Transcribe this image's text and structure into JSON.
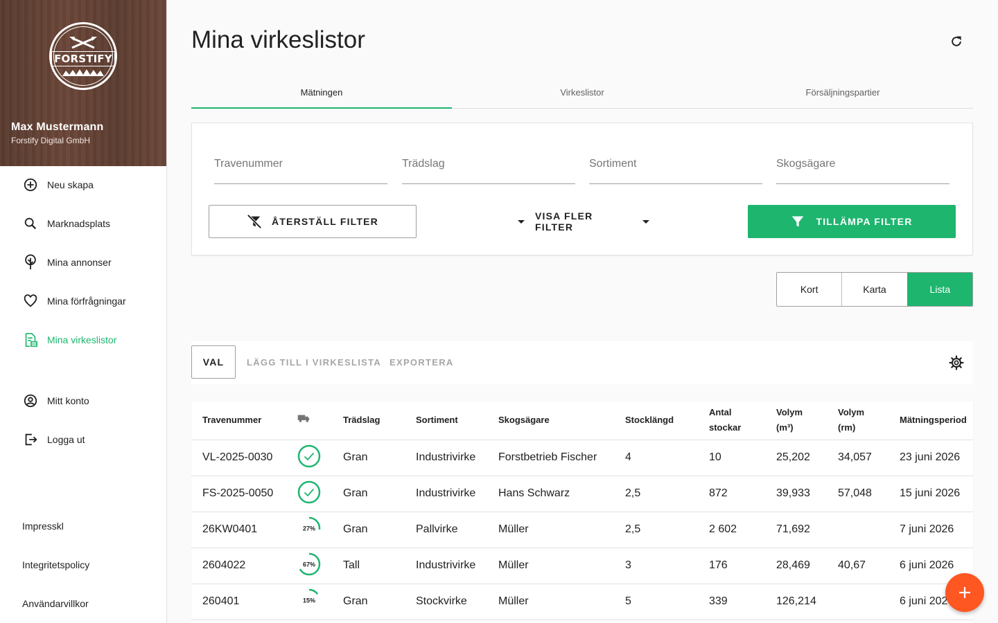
{
  "sidebar": {
    "logo_text": "FORSTIFY",
    "user_name": "Max Mustermann",
    "user_company": "Forstify Digital GmbH",
    "nav": [
      {
        "label": "Neu skapa",
        "icon": "plus-circle-icon"
      },
      {
        "label": "Marknadsplats",
        "icon": "search-icon"
      },
      {
        "label": "Mina annonser",
        "icon": "tree-icon"
      },
      {
        "label": "Mina förfrågningar",
        "icon": "heart-icon"
      },
      {
        "label": "Mina virkeslistor",
        "icon": "document-list-icon",
        "active": true
      },
      {
        "label": "Mitt konto",
        "icon": "account-circle-icon"
      },
      {
        "label": "Logga ut",
        "icon": "logout-icon"
      }
    ],
    "footer": [
      "Impresskl",
      "Integritetspolicy",
      "Användarvillkor"
    ]
  },
  "header": {
    "title": "Mina virkeslistor"
  },
  "tabs": [
    "Mätningen",
    "Virkeslistor",
    "Försäljningspartier"
  ],
  "filters": {
    "fields": [
      {
        "placeholder": "Travenummer",
        "value": ""
      },
      {
        "placeholder": "Trädslag",
        "value": ""
      },
      {
        "placeholder": "Sortiment",
        "value": ""
      },
      {
        "placeholder": "Skogsägare",
        "value": ""
      }
    ],
    "reset_label": "ÅTERSTÄLL FILTER",
    "more_label": "VISA FLER FILTER",
    "apply_label": "TILLÄMPA FILTER"
  },
  "view_toggle": {
    "options": [
      "Kort",
      "Karta",
      "Lista"
    ],
    "selected": "Lista"
  },
  "actions": {
    "select_label": "VAL",
    "add_label": "LÄGG TILL I VIRKESLISTA",
    "export_label": "EXPORTERA"
  },
  "colors": {
    "accent": "#1eb56f",
    "fab": "#ff5722"
  },
  "table": {
    "columns": [
      {
        "line1": "Travenummer",
        "line2": ""
      },
      {
        "line1": "",
        "line2": "",
        "icon": "truck-icon"
      },
      {
        "line1": "Trädslag",
        "line2": ""
      },
      {
        "line1": "Sortiment",
        "line2": ""
      },
      {
        "line1": "Skogsägare",
        "line2": ""
      },
      {
        "line1": "Stocklängd",
        "line2": ""
      },
      {
        "line1": "Antal",
        "line2": "stockar"
      },
      {
        "line1": "Volym",
        "line2": "(m³)"
      },
      {
        "line1": "Volym",
        "line2": "(rm)"
      },
      {
        "line1": "Mätningsperiod",
        "line2": ""
      }
    ],
    "rows": [
      {
        "trave": "VL-2025-0030",
        "status": "done",
        "progress": 100,
        "progress_label": "",
        "species": "Gran",
        "assortment": "Industrivirke",
        "owner": "Forstbetrieb Fischer",
        "length": "4",
        "count": "10",
        "vol_m3": "25,202",
        "vol_rm": "34,057",
        "period": "23 juni 2026"
      },
      {
        "trave": "FS-2025-0050",
        "status": "done",
        "progress": 100,
        "progress_label": "",
        "species": "Gran",
        "assortment": "Industrivirke",
        "owner": "Hans Schwarz",
        "length": "2,5",
        "count": "872",
        "vol_m3": "39,933",
        "vol_rm": "57,048",
        "period": "15 juni 2026"
      },
      {
        "trave": "26KW0401",
        "status": "progress",
        "progress": 27,
        "progress_label": "27%",
        "species": "Gran",
        "assortment": "Pallvirke",
        "owner": "Müller",
        "length": "2,5",
        "count": "2 602",
        "vol_m3": "71,692",
        "vol_rm": "",
        "period": "7 juni 2026"
      },
      {
        "trave": "2604022",
        "status": "progress",
        "progress": 67,
        "progress_label": "67%",
        "species": "Tall",
        "assortment": "Industrivirke",
        "owner": "Müller",
        "length": "3",
        "count": "176",
        "vol_m3": "28,469",
        "vol_rm": "40,67",
        "period": "6 juni 2026"
      },
      {
        "trave": "260401",
        "status": "progress",
        "progress": 15,
        "progress_label": "15%",
        "species": "Gran",
        "assortment": "Stockvirke",
        "owner": "Müller",
        "length": "5",
        "count": "339",
        "vol_m3": "126,214",
        "vol_rm": "",
        "period": "6 juni 2026"
      }
    ]
  }
}
